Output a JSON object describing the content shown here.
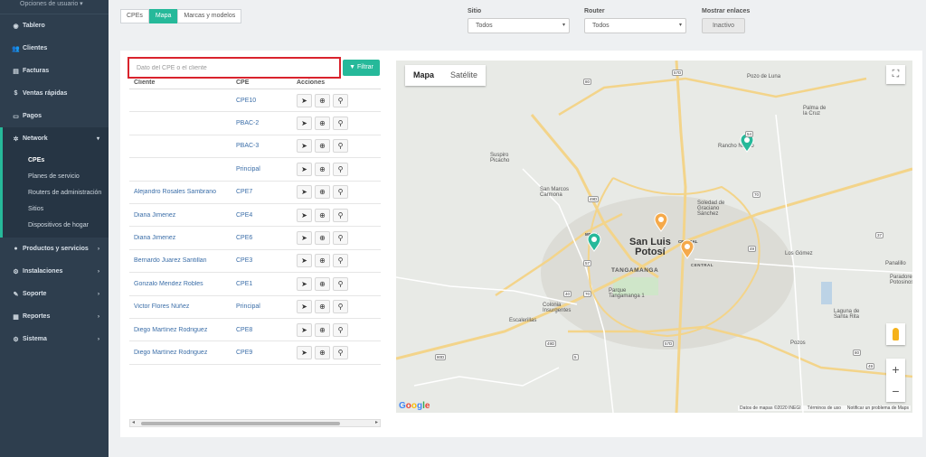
{
  "sidebar": {
    "user_options": "Opciones de usuario ▾",
    "items": [
      {
        "label": "Tablero",
        "icon": "dashboard-icon",
        "glyph": "◉"
      },
      {
        "label": "Clientes",
        "icon": "users-icon",
        "glyph": "👥"
      },
      {
        "label": "Facturas",
        "icon": "invoice-icon",
        "glyph": "▤"
      },
      {
        "label": "Ventas rápidas",
        "icon": "dollar-icon",
        "glyph": "$"
      },
      {
        "label": "Pagos",
        "icon": "payment-icon",
        "glyph": "▭"
      }
    ],
    "network": {
      "label": "Network",
      "icon": "network-icon",
      "glyph": "✲"
    },
    "submenu": [
      "CPEs",
      "Planes de servicio",
      "Routers de administración",
      "Sitios",
      "Dispositivos de hogar"
    ],
    "items_after": [
      {
        "label": "Productos y servicios",
        "icon": "products-icon",
        "glyph": "●"
      },
      {
        "label": "Instalaciones",
        "icon": "installations-icon",
        "glyph": "⚙"
      },
      {
        "label": "Soporte",
        "icon": "wrench-icon",
        "glyph": "✎"
      },
      {
        "label": "Reportes",
        "icon": "reports-icon",
        "glyph": "▦"
      },
      {
        "label": "Sistema",
        "icon": "system-icon",
        "glyph": "⚙"
      }
    ]
  },
  "tabs": [
    "CPEs",
    "Mapa",
    "Marcas y modelos"
  ],
  "filters": {
    "sitio_label": "Sitio",
    "sitio_value": "Todos",
    "router_label": "Router",
    "router_value": "Todos",
    "links_label": "Mostrar enlaces",
    "links_value": "Inactivo"
  },
  "search": {
    "placeholder": "Dato del CPE o el cliente",
    "value": ""
  },
  "filter_button": "Filtrar",
  "table": {
    "headers": [
      "Cliente",
      "CPE",
      "Acciones"
    ],
    "rows": [
      {
        "client": "",
        "cpe": "CPE10"
      },
      {
        "client": "",
        "cpe": "PBAC-2"
      },
      {
        "client": "",
        "cpe": "PBAC-3"
      },
      {
        "client": "",
        "cpe": "Principal"
      },
      {
        "client": "Alejandro Rosales Sambrano",
        "cpe": "CPE7"
      },
      {
        "client": "Diana Jimenez",
        "cpe": "CPE4"
      },
      {
        "client": "Diana Jimenez",
        "cpe": "CPE6"
      },
      {
        "client": "Bernardo Juarez Santillan",
        "cpe": "CPE3"
      },
      {
        "client": "Gonzalo Mendez Robles",
        "cpe": "CPE1"
      },
      {
        "client": "Victor Flores Núñez",
        "cpe": "Principal"
      },
      {
        "client": "Diego Martínez Rodriguez",
        "cpe": "CPE8"
      },
      {
        "client": "Diego Martínez Rodriguez",
        "cpe": "CPE9"
      }
    ]
  },
  "map": {
    "types": [
      "Mapa",
      "Satélite"
    ],
    "google": "Google",
    "footer": [
      "Datos de mapas ©2020 INEGI",
      "Términos de uso",
      "Notificar un problema de Maps"
    ],
    "city": "San Luis\nPotosí",
    "neighborhoods": [
      "TANGAMANGA",
      "CENTRAL"
    ],
    "markers": [
      {
        "label": "MIMEA",
        "color": "#26b99a"
      },
      {
        "label": "",
        "color": "#26b99a"
      },
      {
        "label": "",
        "color": "#f5a94a"
      },
      {
        "label": "CENTRAL",
        "color": "#f5a94a"
      }
    ],
    "places": [
      "Pozo de Luna",
      "Palma de\nla Cruz",
      "Rancho Nuevo",
      "Suspiro\nPicacho",
      "San Marcos\nCarmona",
      "Soledad de\nGraciano\nSánchez",
      "Los Gómez",
      "Panalillo",
      "Paradores\nPotosinos",
      "Parque\nTangamanga 1",
      "Colonia\nInsurgentes",
      "Escalerillas",
      "Laguna de\nSanta Rita",
      "Pozos",
      "de Carmona"
    ],
    "highway_shields": [
      "80",
      "49D",
      "57",
      "70",
      "40",
      "5",
      "57D",
      "54",
      "70",
      "49",
      "37",
      "80D",
      "49D",
      "57D",
      "80",
      "49"
    ]
  },
  "colors": {
    "accent": "#26b99a",
    "sidebar": "#2e3e4e",
    "highlight": "#d9232d",
    "link": "#3b6ea8"
  }
}
